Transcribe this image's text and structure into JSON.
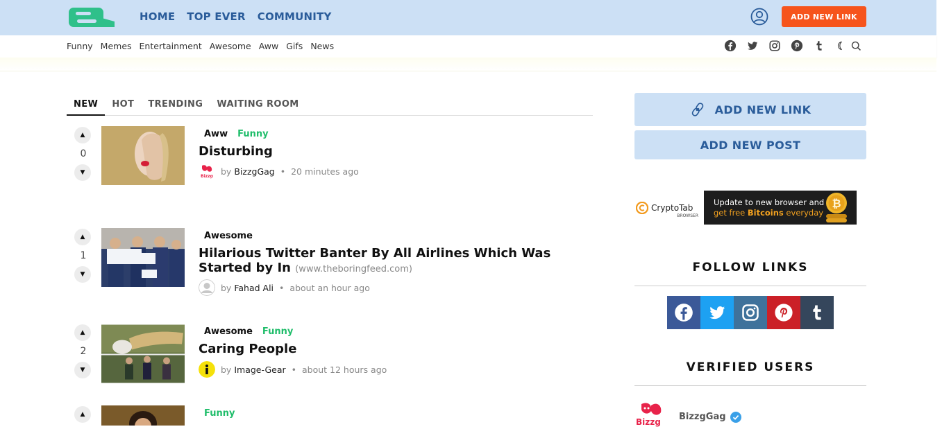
{
  "header": {
    "nav": [
      "HOME",
      "TOP EVER",
      "COMMUNITY"
    ],
    "add_link_label": "ADD NEW LINK",
    "categories": [
      "Funny",
      "Memes",
      "Entertainment",
      "Awesome",
      "Aww",
      "Gifs",
      "News"
    ],
    "social_icons": [
      "facebook-icon",
      "twitter-icon",
      "instagram-icon",
      "pinterest-icon",
      "tumblr-icon",
      "moon-icon",
      "search-icon"
    ]
  },
  "tabs": [
    {
      "label": "NEW",
      "active": true
    },
    {
      "label": "HOT",
      "active": false
    },
    {
      "label": "TRENDING",
      "active": false
    },
    {
      "label": "WAITING ROOM",
      "active": false
    }
  ],
  "posts": [
    {
      "votes": "0",
      "tags": [
        "Aww",
        "Funny"
      ],
      "title": "Disturbing",
      "source": "",
      "author": "BizzgGag",
      "time": "20 minutes ago"
    },
    {
      "votes": "1",
      "tags": [
        "Awesome"
      ],
      "title": "Hilarious Twitter Banter By All Airlines Which Was Started by In",
      "source": "(www.theboringfeed.com)",
      "author": "Fahad Ali",
      "time": "about an hour ago"
    },
    {
      "votes": "2",
      "tags": [
        "Awesome",
        "Funny"
      ],
      "title": "Caring People",
      "source": "",
      "author": "Image-Gear",
      "time": "about 12 hours ago"
    },
    {
      "votes": "",
      "tags": [
        "Funny"
      ],
      "title": "",
      "source": "",
      "author": "",
      "time": ""
    }
  ],
  "sidebar": {
    "add_link_label": "ADD NEW LINK",
    "add_post_label": "ADD NEW POST",
    "ad": {
      "brand": "CryptoTab",
      "brand_sub": "BROWSER",
      "line1": "Update to new browser and",
      "line2_prefix": "get free ",
      "line2_bold": "Bitcoins",
      "line2_suffix": " everyday"
    },
    "follow_heading": "FOLLOW LINKS",
    "follow_colors": {
      "facebook": "#3b5998",
      "twitter": "#1da1f2",
      "instagram": "#3f729b",
      "pinterest": "#cb2027",
      "tumblr": "#35465c"
    },
    "verified_heading": "VERIFIED USERS",
    "verified_user": "BizzgGag"
  },
  "colors": {
    "accent": "#f6541c",
    "brand_blue": "#2a5c9a",
    "topbar": "#cce0f5",
    "tag_green": "#1fbd6a"
  }
}
